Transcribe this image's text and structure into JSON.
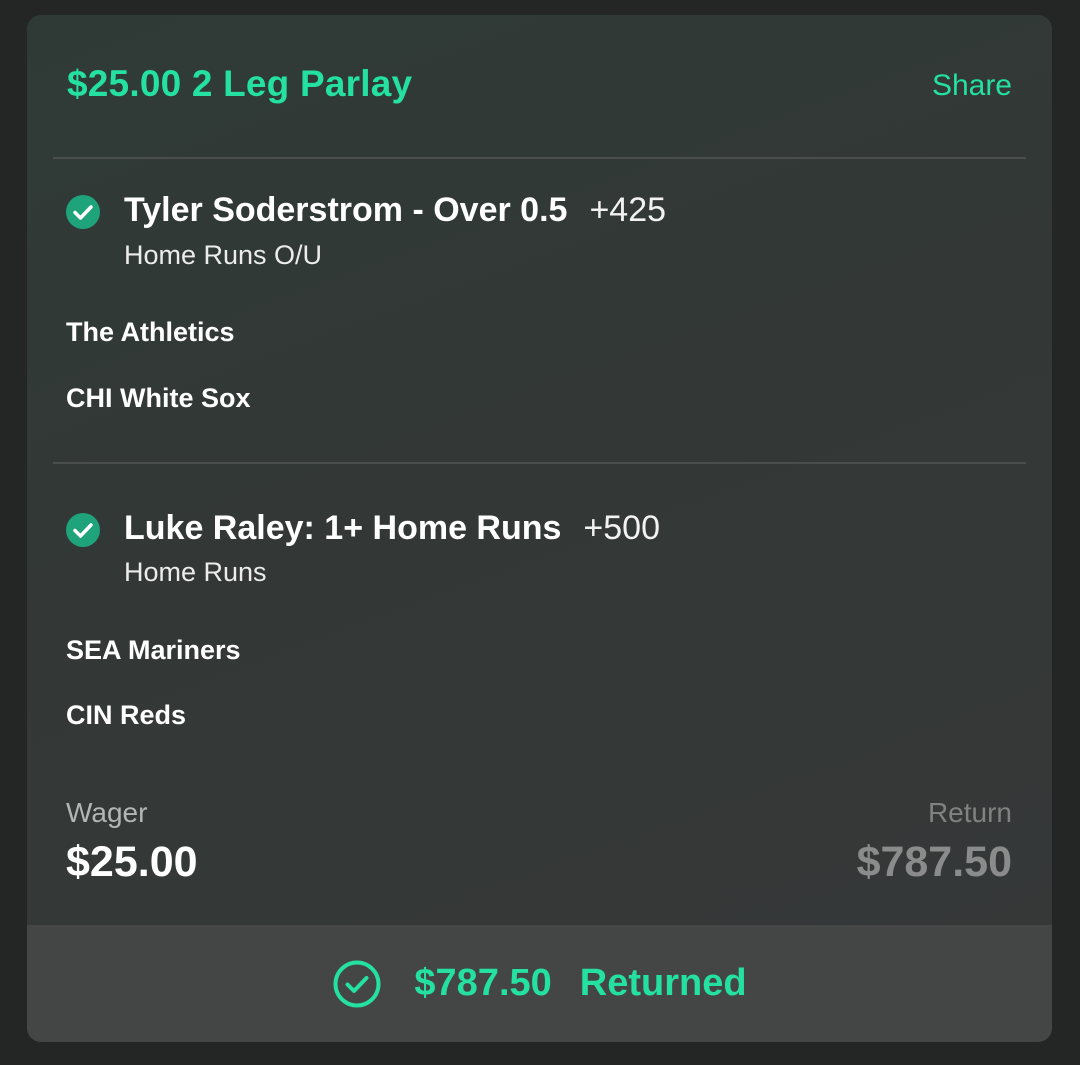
{
  "header": {
    "title": "$25.00 2 Leg Parlay",
    "share_label": "Share"
  },
  "legs": [
    {
      "status": "won",
      "pick": "Tyler Soderstrom - Over 0.5",
      "odds": "+425",
      "market": "Home Runs O/U",
      "team_1": "The Athletics",
      "team_2": "CHI White Sox"
    },
    {
      "status": "won",
      "pick": "Luke Raley: 1+ Home Runs",
      "odds": "+500",
      "market": "Home Runs",
      "team_1": "SEA Mariners",
      "team_2": "CIN Reds"
    }
  ],
  "summary": {
    "wager_label": "Wager",
    "wager_value": "$25.00",
    "return_label": "Return",
    "return_value": "$787.50"
  },
  "footer": {
    "amount": "$787.50",
    "status": "Returned"
  },
  "colors": {
    "accent": "#24e0a1",
    "check_fill": "#1fa37a",
    "card_bg": "#333836",
    "footer_bg": "#444645"
  }
}
